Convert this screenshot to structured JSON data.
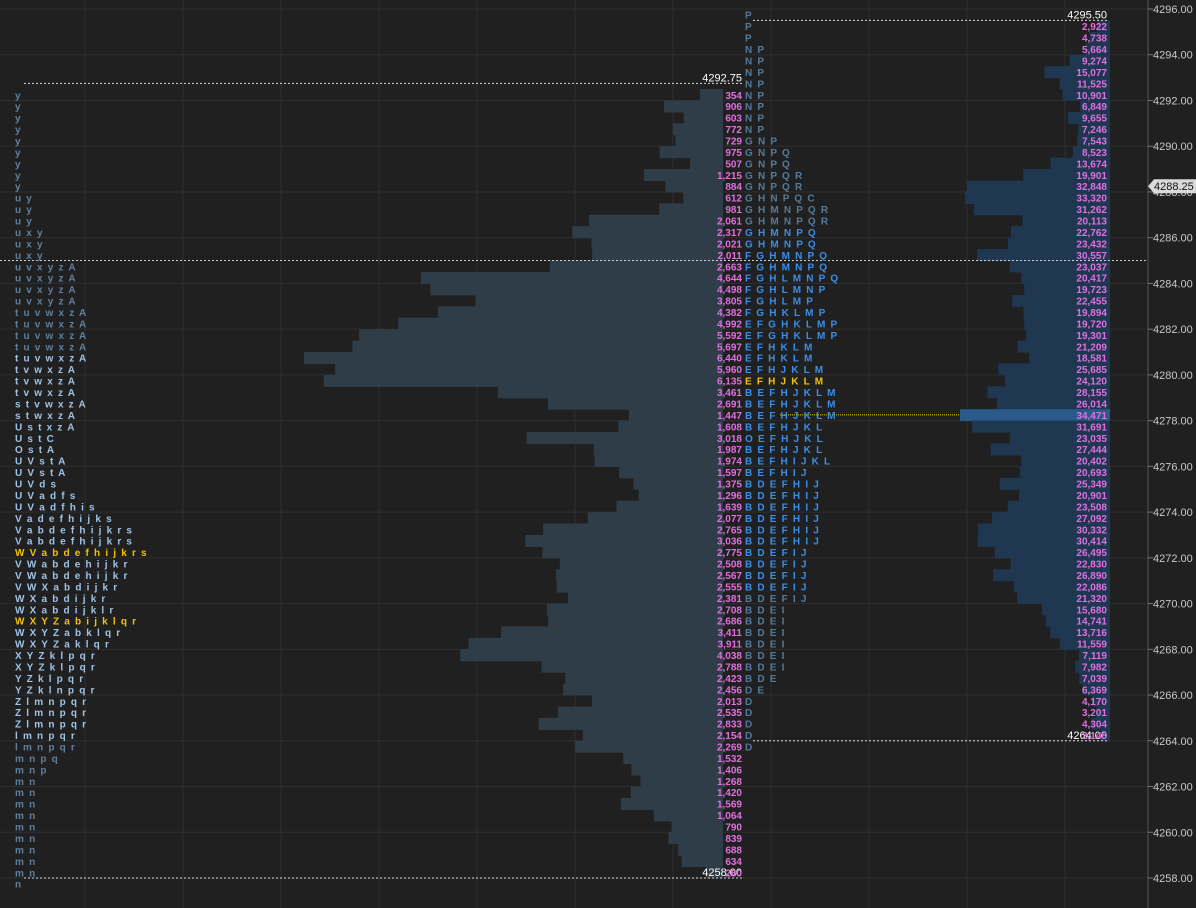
{
  "chart_data": {
    "type": "market-profile",
    "ylim": [
      4257.5,
      4296.3
    ],
    "tick": 0.25,
    "row_step": 0.5,
    "y_ticks": [
      "4296.00",
      "4294.00",
      "4292.00",
      "4290.00",
      "4288.00",
      "4286.00",
      "4284.00",
      "4282.00",
      "4280.00",
      "4278.00",
      "4276.00",
      "4274.00",
      "4272.00",
      "4270.00",
      "4268.00",
      "4266.00",
      "4264.00",
      "4262.00",
      "4260.00",
      "4258.00"
    ],
    "current_price": "4288.25",
    "poc_price": 4281.5,
    "vwap_price": 4285.0,
    "developing_poc_price": 4278.25,
    "levels": {
      "left_high": "4292.75",
      "left_low": "4258.00",
      "right_high": "4295.50",
      "right_low": "4264.00"
    },
    "left_profile": {
      "top_price": 4292.25,
      "letters": [
        "y",
        "y",
        "y",
        "y",
        "y",
        "y",
        "y",
        "y",
        "y",
        "u y",
        "u y",
        "u y",
        "u x y",
        "u x y",
        "u x y",
        "u v x y z A",
        "u v x y z A",
        "u v x y z A",
        "u v x y z A",
        "t u v w x z A",
        "t u v w x z A",
        "t u v w x z A",
        "t u v w x z A",
        "t u v w x z A",
        "t v w x z A",
        "t v w x z A",
        "t v w x z A",
        "s t v w x z A",
        "s t w x z A",
        "U s t x z A",
        "U s t C",
        "O s t A",
        "U V s t A",
        "U V s t A",
        "U V d s",
        "U V a d f s",
        "U V a d f h i s",
        "V a d e f h i j k s",
        "V a b d e f h i j k r s",
        "V a b d e f h i j k r s",
        "W V a b d e f h i j k r s",
        "V W a b d e h i j k r",
        "V W a b d e h i j k r",
        "V W X a b d i j k r",
        "W X a b d i j k r",
        "W X a b d i j k l r",
        "W X Y Z a b i j k l q r",
        "W X Y Z a b k l q r",
        "W X Y Z a k l q r",
        "X Y Z k l p q r",
        "X Y Z k l p q r",
        "Y Z k l p q r",
        "Y Z k l n p q r",
        "Z l m n p q r",
        "Z l m n p q r",
        "Z l m n p q r",
        "l m n p q r",
        "l m n p q r",
        "m n p q",
        "m n p",
        "m n",
        "m n",
        "m n",
        "m n",
        "m n",
        "m n",
        "m n",
        "m n",
        "m n",
        "n"
      ]
    },
    "volume_profile": {
      "top_price": 4292.25,
      "volumes": [
        "354",
        "906",
        "603",
        "772",
        "729",
        "975",
        "507",
        "1,215",
        "884",
        "612",
        "981",
        "2,061",
        "2,317",
        "2,021",
        "2,011",
        "2,663",
        "4,644",
        "4,498",
        "3,805",
        "4,382",
        "4,992",
        "5,592",
        "5,697",
        "6,440",
        "5,960",
        "6,135",
        "3,461",
        "2,691",
        "1,447",
        "1,608",
        "3,018",
        "1,987",
        "1,974",
        "1,597",
        "1,375",
        "1,296",
        "1,639",
        "2,077",
        "2,765",
        "3,036",
        "2,775",
        "2,508",
        "2,567",
        "2,555",
        "2,381",
        "2,708",
        "2,686",
        "3,411",
        "3,911",
        "4,038",
        "2,788",
        "2,423",
        "2,456",
        "2,013",
        "2,535",
        "2,833",
        "2,154",
        "2,269",
        "1,532",
        "1,406",
        "1,268",
        "1,420",
        "1,569",
        "1,064",
        "790",
        "839",
        "688",
        "634",
        "260"
      ]
    },
    "tpo_profile": {
      "top_price": 4295.75,
      "letters": [
        "P",
        "P",
        "P",
        "N P",
        "N P",
        "N P",
        "N P",
        "N P",
        "N P",
        "N P",
        "N P",
        "G N P",
        "G N P Q",
        "G N P Q",
        "G N P Q R",
        "G N P Q R",
        "G H N P Q C",
        "G H M N P Q R",
        "G H M N P Q R",
        "G H M N P Q",
        "G H M N P Q",
        "F G H M N P Q",
        "F G H M N P Q",
        "F G H L M N P Q",
        "F G H L M N P",
        "F G H L M P",
        "F G H K L M P",
        "E F G H K L M P",
        "E F G H K L M P",
        "E F H K L M",
        "E F H K L M",
        "E F H J K L M",
        "E F H J K L M",
        "B E F H J K L M",
        "B E F H J K L M",
        "B E F H J K L M",
        "B E F H J K L",
        "O E F H J K L",
        "B E F H J K L",
        "B E F H I J K L",
        "B E F H I J",
        "B D E F H I J",
        "B D E F H I J",
        "B D E F H I J",
        "B D E F H I J",
        "B D E F H I J",
        "B D E F H I J",
        "B D E F I J",
        "B D E F I J",
        "B D E F I J",
        "B D E F I J",
        "B D E F I J",
        "B D E I",
        "B D E I",
        "B D E I",
        "B D E I",
        "B D E I",
        "B D E I",
        "B D E",
        "D E",
        "D",
        "D",
        "D",
        "D",
        "D"
      ]
    },
    "right_profile": {
      "top_price": 4295.25,
      "volumes": [
        "2,922",
        "4,738",
        "5,664",
        "9,274",
        "15,077",
        "11,525",
        "10,901",
        "6,849",
        "9,655",
        "7,246",
        "7,543",
        "8,523",
        "13,674",
        "19,901",
        "32,848",
        "33,320",
        "31,262",
        "20,113",
        "22,762",
        "23,432",
        "30,557",
        "23,037",
        "20,417",
        "19,723",
        "22,455",
        "19,894",
        "19,720",
        "19,301",
        "21,209",
        "18,581",
        "25,685",
        "24,120",
        "28,155",
        "26,014",
        "34,471",
        "31,691",
        "23,035",
        "27,444",
        "20,402",
        "20,693",
        "25,349",
        "20,901",
        "23,508",
        "27,092",
        "30,332",
        "30,414",
        "26,495",
        "22,830",
        "26,890",
        "22,086",
        "21,320",
        "15,680",
        "14,741",
        "13,716",
        "11,559",
        "7,119",
        "7,982",
        "7,039",
        "6,369",
        "4,170",
        "3,201",
        "4,304",
        "2,148"
      ]
    },
    "colors": {
      "background": "#202020",
      "grid": "#2e2e2e",
      "axis_text": "#c8c8c8",
      "volume_text": "#e070e0",
      "tpo_blue": "#3a8ee6",
      "tpo_dim": "#557a99",
      "tpo_green": "#2ea84a",
      "left_letters": "#9fc3e6",
      "left_letters_dim": "#5f7f9e",
      "highlight": "#f2c200",
      "hist_fill": "#2f3d48",
      "poc_fill": "#3d5466",
      "right_fill": "#1f3750",
      "right_poc": "#2a5a8a"
    }
  }
}
